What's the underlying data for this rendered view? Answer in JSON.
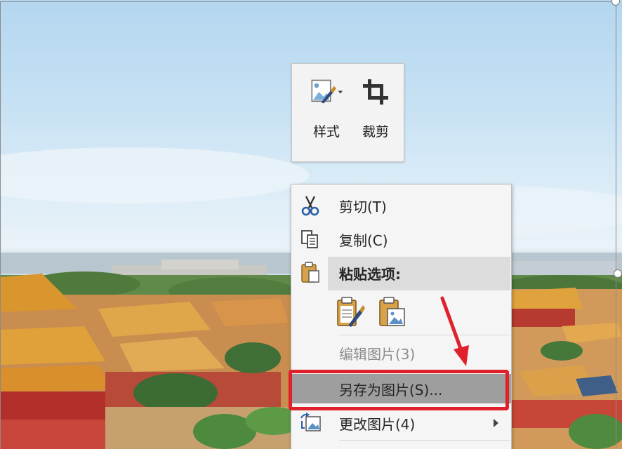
{
  "toolbar": {
    "style_label": "样式",
    "crop_label": "裁剪"
  },
  "menu": {
    "cut_label": "剪切(T)",
    "copy_label": "复制(C)",
    "paste_options_label": "粘贴选项:",
    "edit_picture_label": "编辑图片(3)",
    "save_as_picture_label": "另存为图片(S)...",
    "change_picture_label": "更改图片(4)"
  },
  "colors": {
    "highlight_box": "#e0202a",
    "menu_background": "#f5f5f5",
    "hover_item": "#9e9e9e"
  }
}
